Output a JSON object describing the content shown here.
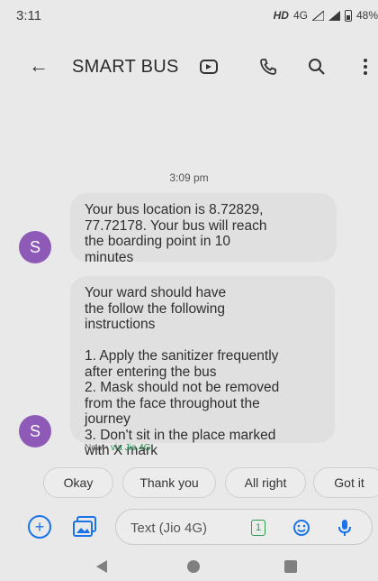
{
  "status_bar": {
    "time": "3:11",
    "hd": "HD",
    "network": "4G",
    "battery": "48%"
  },
  "app_bar": {
    "title": "SMART BUS",
    "icons": [
      "arrow-back-icon",
      "video-call-icon",
      "phone-icon",
      "search-icon",
      "more-vert-icon"
    ]
  },
  "conversation": {
    "timestamp": "3:09 pm",
    "messages": [
      {
        "avatar": "S",
        "text": "Your bus location is 8.72829,\n77.72178. Your bus will reach\nthe boarding point in 10\nminutes"
      },
      {
        "avatar": "S",
        "text": "Your ward should have\nthe follow the following\ninstructions\n\n1. Apply the sanitizer frequently\nafter entering the bus\n2. Mask should not be removed\nfrom the face throughout the\njourney\n3. Don't sit in the place marked\nwith X mark"
      }
    ],
    "status_prefix": "Now • ",
    "status_network": "via Jio 4G"
  },
  "smart_replies": [
    "Okay",
    "Thank you",
    "All right",
    "Got it"
  ],
  "compose": {
    "placeholder": "Text (Jio 4G)",
    "sim_label": "1"
  },
  "colors": {
    "avatar": "#8e5ab8",
    "accent": "#1a73e8",
    "sim": "#2e9b4f"
  }
}
